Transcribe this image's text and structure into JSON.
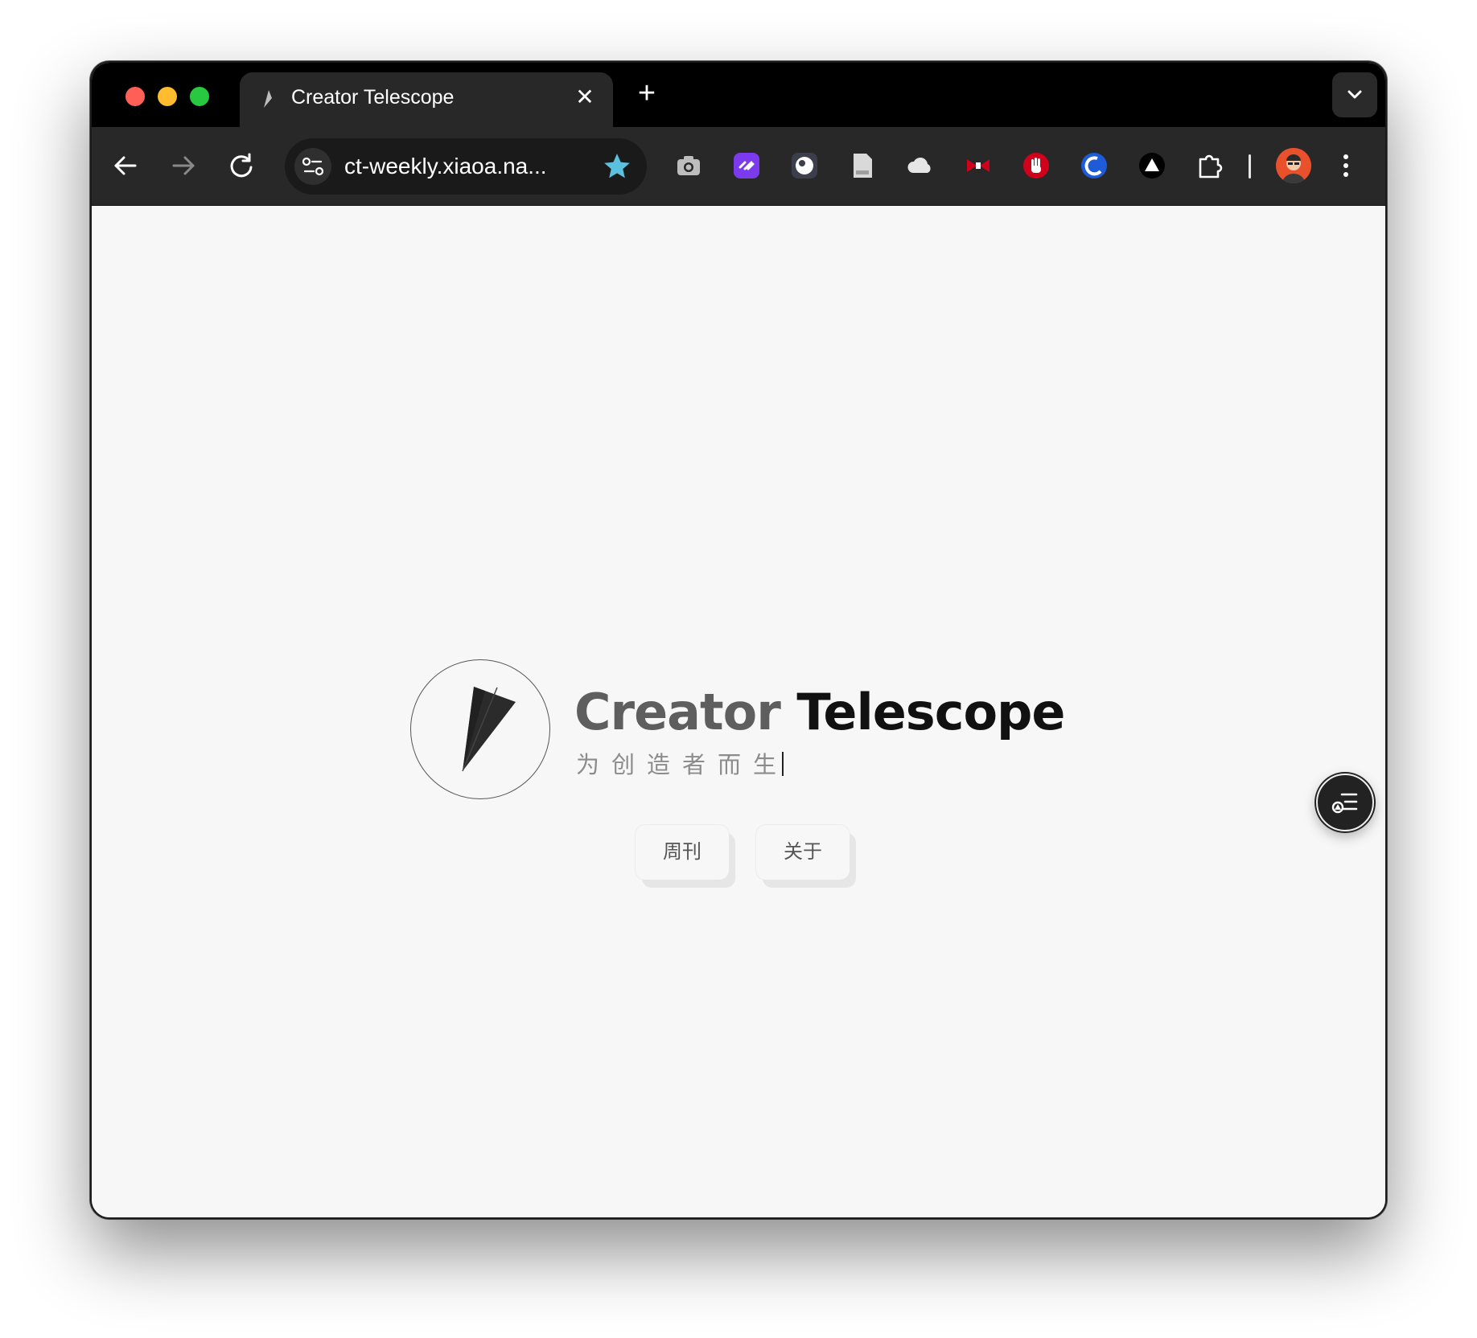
{
  "browser": {
    "tab": {
      "title": "Creator Telescope",
      "close_glyph": "✕"
    },
    "new_tab_glyph": "+",
    "address": {
      "url": "ct-weekly.xiaoa.na..."
    },
    "icons": {
      "back": "arrow-left-icon",
      "forward": "arrow-right-icon",
      "reload": "reload-icon",
      "site_info": "tune-icon",
      "bookmark": "star-icon",
      "extensions": [
        "camera-icon",
        "link-extension-icon",
        "eye-extension-icon",
        "document-icon",
        "cloud-icon",
        "bowtie-extension-icon",
        "hand-stop-icon",
        "globe-extension-icon",
        "triangle-extension-icon",
        "puzzle-icon"
      ],
      "menu": "more-vert-icon"
    },
    "colors": {
      "star": "#5bc0de",
      "traffic_red": "#ff5f57",
      "traffic_yellow": "#febc2e",
      "traffic_green": "#28c840"
    }
  },
  "page": {
    "brand": {
      "title_part1": "Creator",
      "title_part2": "Telescope",
      "tagline": "为创造者而生"
    },
    "nav": {
      "weekly_label": "周刊",
      "about_label": "关于"
    }
  }
}
